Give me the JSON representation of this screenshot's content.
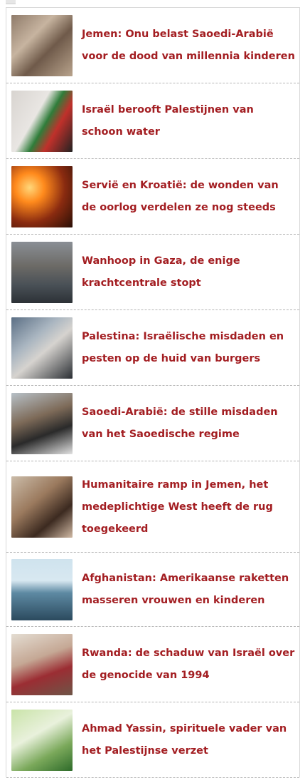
{
  "articles": [
    {
      "title": "Jemen: Onu belast Saoedi-Arabië voor de dood van millennia kinderen",
      "thumb": "child-injured-photo"
    },
    {
      "title": "Israël berooft Palestijnen van schoon water",
      "thumb": "woman-with-flag-photo"
    },
    {
      "title": "Servië en Kroatië: de wonden van de oorlog verdelen ze nog steeds",
      "thumb": "city-burning-photo"
    },
    {
      "title": "Wanhoop in Gaza, de enige krachtcentrale stopt",
      "thumb": "flooded-street-photo"
    },
    {
      "title": "Palestina: Israëlische misdaden en pesten op de huid van burgers",
      "thumb": "crowd-carrying-child-photo"
    },
    {
      "title": "Saoedi-Arabië: de stille misdaden van het Saoedische regime",
      "thumb": "kneeling-prisoner-photo"
    },
    {
      "title": "Humanitaire ramp in Jemen, het medeplichtige West heeft de rug toegekeerd",
      "thumb": "crying-child-photo"
    },
    {
      "title": "Afghanistan: Amerikaanse raketten masseren vrouwen en kinderen",
      "thumb": "drone-photo"
    },
    {
      "title": "Rwanda: de schaduw van Israël over de genocide van 1994",
      "thumb": "girl-in-rubble-photo"
    },
    {
      "title": "Ahmad Yassin, spirituele vader van het Palestijnse verzet",
      "thumb": "ahmad-yassin-poster-photo"
    }
  ]
}
